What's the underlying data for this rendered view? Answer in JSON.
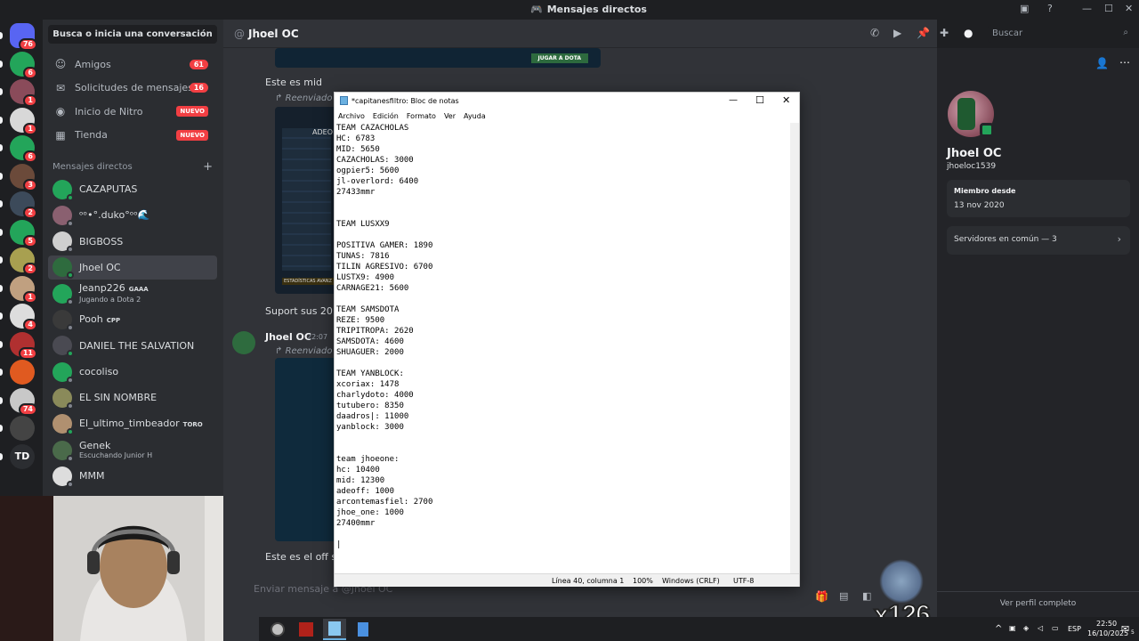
{
  "window": {
    "title": "Mensajes directos"
  },
  "rail": {
    "servers": [
      {
        "label": "",
        "badge": "76",
        "color": "#5865f2"
      },
      {
        "label": "",
        "badge": "6",
        "color": "#23a55a"
      },
      {
        "label": "",
        "badge": "1",
        "color": "#8a4b5a"
      },
      {
        "label": "",
        "badge": "1",
        "color": "#d8d8d8"
      },
      {
        "label": "",
        "badge": "6",
        "color": "#23a55a"
      },
      {
        "label": "",
        "badge": "3",
        "color": "#6b4a3a"
      },
      {
        "label": "",
        "badge": "2",
        "color": "#3c4a5a"
      },
      {
        "label": "",
        "badge": "5",
        "color": "#23a55a"
      },
      {
        "label": "",
        "badge": "2",
        "color": "#a8a050"
      },
      {
        "label": "",
        "badge": "1",
        "color": "#c0a080"
      },
      {
        "label": "",
        "badge": "4",
        "color": "#ddd"
      },
      {
        "label": "",
        "badge": "11",
        "color": "#b03030"
      },
      {
        "label": "",
        "badge": "",
        "color": "#e05a20"
      },
      {
        "label": "",
        "badge": "74",
        "color": "#c8c8c8"
      },
      {
        "label": "",
        "badge": "",
        "color": "#444"
      },
      {
        "label": "TD",
        "badge": "",
        "color": "#2b2d31"
      }
    ]
  },
  "sidebar": {
    "search_label": "Busca o inicia una conversación",
    "nav": [
      {
        "label": "Amigos",
        "count": "61",
        "icon": "friends-icon",
        "glyph": "☺"
      },
      {
        "label": "Solicitudes de mensajes",
        "count": "16",
        "icon": "envelope-icon",
        "glyph": "✉"
      },
      {
        "label": "Inicio de Nitro",
        "badge": "NUEVO",
        "icon": "nitro-icon",
        "glyph": "◉"
      },
      {
        "label": "Tienda",
        "badge": "NUEVO",
        "icon": "shop-icon",
        "glyph": "▦"
      }
    ],
    "dm_header": "Mensajes directos",
    "dms": [
      {
        "name": "CAZAPUTAS",
        "sub": "",
        "tag": "",
        "color": "#23a55a"
      },
      {
        "name": "ᵒᵒ•°.duko°ᵒᵒ🌊",
        "sub": "",
        "tag": "",
        "color": "#8a6070"
      },
      {
        "name": "BIGBOSS",
        "sub": "",
        "tag": "",
        "color": "#cfcfcf"
      },
      {
        "name": "Jhoel OC",
        "sub": "",
        "tag": "",
        "color": "#2e6b3e"
      },
      {
        "name": "Jeanp226",
        "sub": "Jugando a Dota 2",
        "tag": "GAAA",
        "color": "#23a55a"
      },
      {
        "name": "Pooh",
        "sub": "",
        "tag": "CPP",
        "color": "#3a3a3a"
      },
      {
        "name": "DANIEL THE SALVATION",
        "sub": "",
        "tag": "",
        "color": "#4a4a52"
      },
      {
        "name": "cocoliso",
        "sub": "",
        "tag": "",
        "color": "#23a55a"
      },
      {
        "name": "EL SIN NOMBRE",
        "sub": "",
        "tag": "",
        "color": "#8a8a5a"
      },
      {
        "name": "El_ultimo_timbeador",
        "sub": "",
        "tag": "TORO",
        "color": "#b09070"
      },
      {
        "name": "Genek",
        "sub": "Escuchando Junior H",
        "tag": "",
        "color": "#4a6a4a"
      },
      {
        "name": "MMM",
        "sub": "",
        "tag": "",
        "color": "#ddd"
      }
    ]
  },
  "chat": {
    "recipient": "Jhoel OC",
    "messages": {
      "m1": "Este es mid",
      "forwarded": "Reenviado",
      "m2": "Suport sus 20 últ",
      "author": "Jhoel OC",
      "time": "22:07",
      "m3": "Este es el off sus"
    },
    "img_button": "JUGAR A DOTA",
    "img_stats": "ESTADÍSTICAS AVANZ",
    "img_profile": "ADEO",
    "input_placeholder": "Enviar mensaje a @Jhoel OC"
  },
  "header": {
    "search_placeholder": "Buscar"
  },
  "profile": {
    "display_name": "Jhoel OC",
    "username": "jhoeloc1539",
    "member_since_label": "Miembro desde",
    "member_since": "13 nov 2020",
    "mutual_servers": "Servidores en común — 3",
    "view_full": "Ver perfil completo"
  },
  "notepad": {
    "title": "*capitanesfiltro: Bloc de notas",
    "menu": [
      "Archivo",
      "Edición",
      "Formato",
      "Ver",
      "Ayuda"
    ],
    "content": "TEAM CAZACHOLAS\nHC: 6783\nMID: 5650\nCAZACHOLAS: 3000\nogpier5: 5600\njl-overlord: 6400\n27433mmr\n\n\nTEAM LUSXX9\n\nPOSITIVA GAMER: 1890\nTUNAS: 7816\nTILIN AGRESIVO: 6700\nLUSTX9: 4900\nCARNAGE21: 5600\n\nTEAM SAMSDOTA\nREZE: 9500\nTRIPITROPA: 2620\nSAMSDOTA: 4600\nSHUAGUER: 2000\n\nTEAM YANBLOCK:\nxcoriax: 1478\ncharlydoto: 4000\ntutubero: 8350\ndaadros|: 11000\nyanblock: 3000\n\n\nteam jhoeone:\nhc: 10400\nmid: 12300\nadeoff: 1000\narcontemasfiel: 2700\njhoe_one: 1000\n27400mmr\n\n|",
    "status": {
      "position": "Línea 40, columna 1",
      "zoom": "100%",
      "eol": "Windows (CRLF)",
      "encoding": "UTF-8"
    }
  },
  "overlay": {
    "combo": "x126"
  },
  "tray": {
    "lang": "ESP",
    "time": "22:50",
    "date": "16/10/2025",
    "notif": "5"
  }
}
